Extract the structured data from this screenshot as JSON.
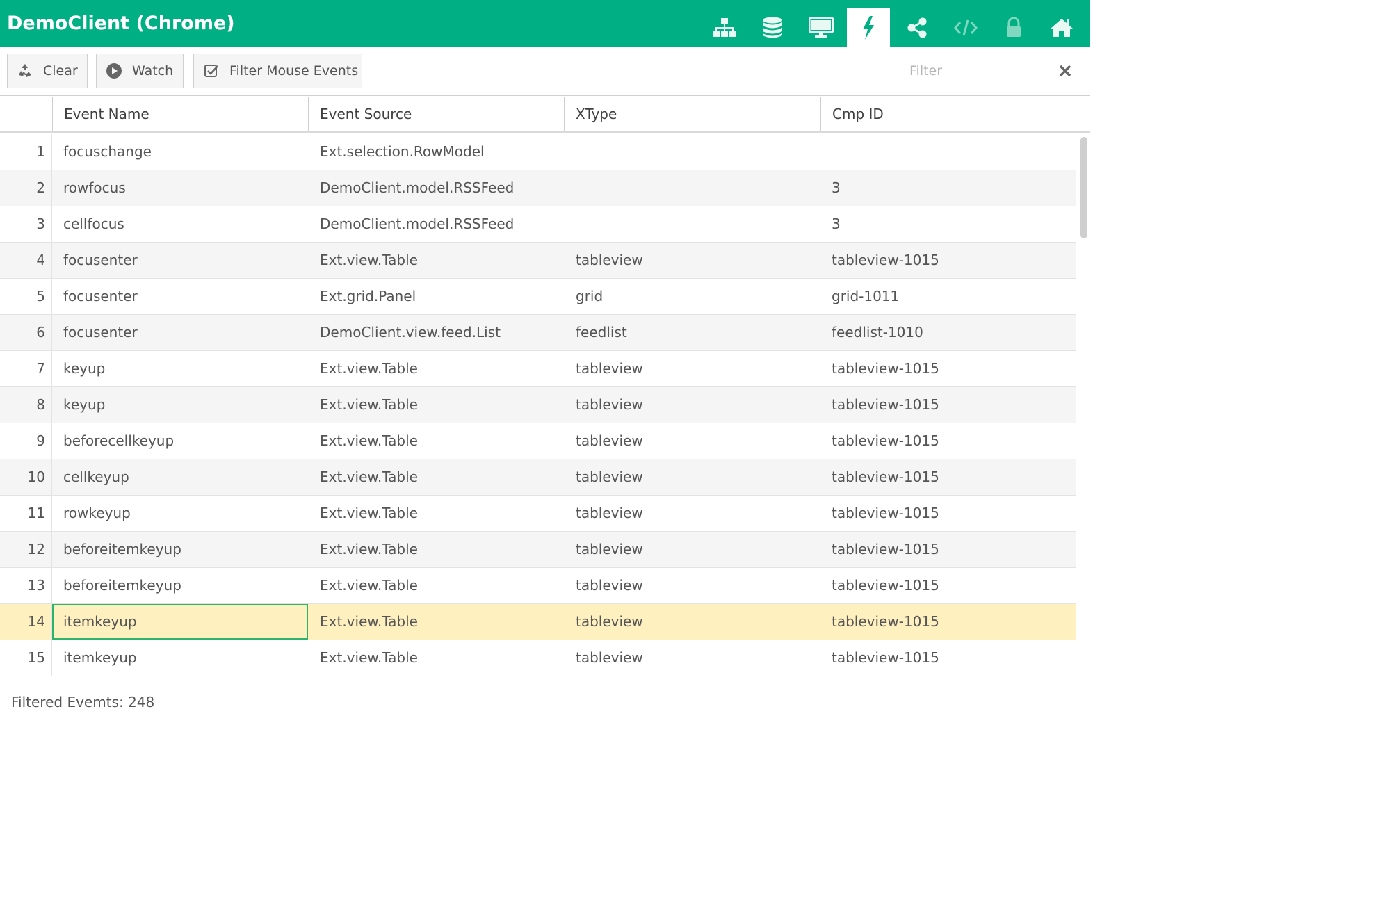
{
  "app": {
    "title": "DemoClient (Chrome)"
  },
  "colors": {
    "accent": "#00b084",
    "selected_row": "#fff0bf",
    "focus_border": "#2db36b"
  },
  "nav_icons": [
    "component-tree-icon",
    "database-icon",
    "monitor-icon",
    "lightning-icon",
    "share-icon",
    "code-icon",
    "lock-icon",
    "home-icon"
  ],
  "nav_active": "lightning-icon",
  "toolbar": {
    "clear_label": "Clear",
    "watch_label": "Watch",
    "filter_mouse_label": "Filter Mouse Events",
    "filter_placeholder": "Filter",
    "filter_value": ""
  },
  "grid": {
    "columns": [
      "Event Name",
      "Event Source",
      "XType",
      "Cmp ID"
    ],
    "rows": [
      {
        "num": "1",
        "name": "focuschange",
        "source": "Ext.selection.RowModel",
        "xtype": "",
        "cmp": ""
      },
      {
        "num": "2",
        "name": "rowfocus",
        "source": "DemoClient.model.RSSFeed",
        "xtype": "",
        "cmp": "3"
      },
      {
        "num": "3",
        "name": "cellfocus",
        "source": "DemoClient.model.RSSFeed",
        "xtype": "",
        "cmp": "3"
      },
      {
        "num": "4",
        "name": "focusenter",
        "source": "Ext.view.Table",
        "xtype": "tableview",
        "cmp": "tableview-1015"
      },
      {
        "num": "5",
        "name": "focusenter",
        "source": "Ext.grid.Panel",
        "xtype": "grid",
        "cmp": "grid-1011"
      },
      {
        "num": "6",
        "name": "focusenter",
        "source": "DemoClient.view.feed.List",
        "xtype": "feedlist",
        "cmp": "feedlist-1010"
      },
      {
        "num": "7",
        "name": "keyup",
        "source": "Ext.view.Table",
        "xtype": "tableview",
        "cmp": "tableview-1015"
      },
      {
        "num": "8",
        "name": "keyup",
        "source": "Ext.view.Table",
        "xtype": "tableview",
        "cmp": "tableview-1015"
      },
      {
        "num": "9",
        "name": "beforecellkeyup",
        "source": "Ext.view.Table",
        "xtype": "tableview",
        "cmp": "tableview-1015"
      },
      {
        "num": "10",
        "name": "cellkeyup",
        "source": "Ext.view.Table",
        "xtype": "tableview",
        "cmp": "tableview-1015"
      },
      {
        "num": "11",
        "name": "rowkeyup",
        "source": "Ext.view.Table",
        "xtype": "tableview",
        "cmp": "tableview-1015"
      },
      {
        "num": "12",
        "name": "beforeitemkeyup",
        "source": "Ext.view.Table",
        "xtype": "tableview",
        "cmp": "tableview-1015"
      },
      {
        "num": "13",
        "name": "beforeitemkeyup",
        "source": "Ext.view.Table",
        "xtype": "tableview",
        "cmp": "tableview-1015"
      },
      {
        "num": "14",
        "name": "itemkeyup",
        "source": "Ext.view.Table",
        "xtype": "tableview",
        "cmp": "tableview-1015",
        "selected": true
      },
      {
        "num": "15",
        "name": "itemkeyup",
        "source": "Ext.view.Table",
        "xtype": "tableview",
        "cmp": "tableview-1015"
      }
    ]
  },
  "footer": {
    "status_text": "Filtered Evemts: 248"
  }
}
